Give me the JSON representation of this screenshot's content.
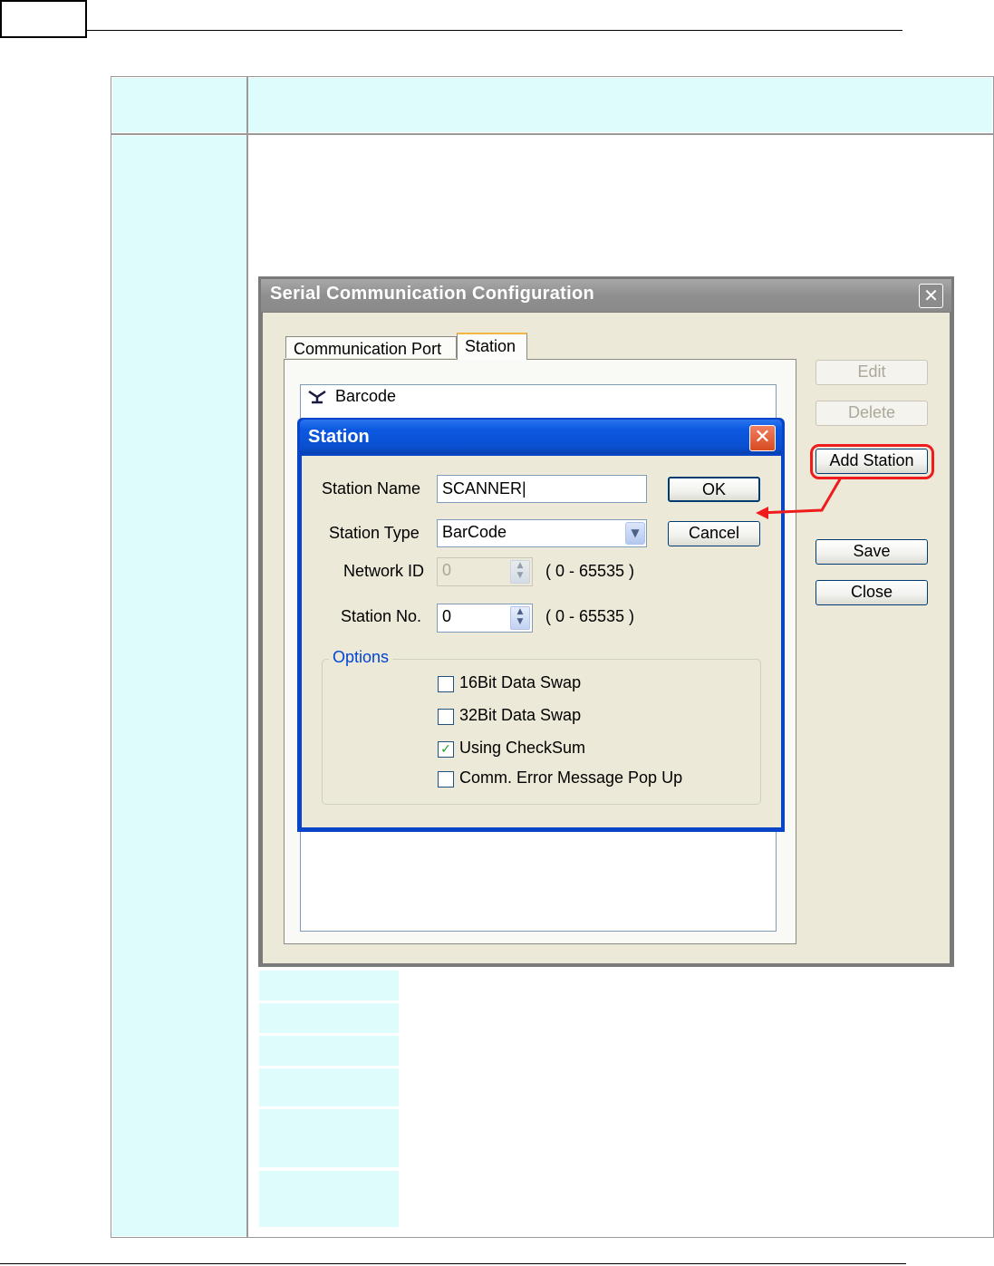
{
  "main_window": {
    "title": "Serial Communication Configuration",
    "close_glyph": "✕",
    "tabs": [
      {
        "label": "Communication Port",
        "active": false
      },
      {
        "label": "Station",
        "active": true
      }
    ],
    "station_list": [
      {
        "label": "Barcode",
        "icon": "antenna-icon"
      }
    ],
    "buttons": {
      "edit": "Edit",
      "delete": "Delete",
      "add_station": "Add Station",
      "save": "Save",
      "close": "Close"
    },
    "disabled_buttons": [
      "Edit",
      "Delete"
    ]
  },
  "station_dialog": {
    "title": "Station",
    "close_glyph": "✕",
    "fields": {
      "station_name_label": "Station Name",
      "station_name_value": "SCANNER|",
      "station_type_label": "Station Type",
      "station_type_value": "BarCode",
      "network_id_label": "Network ID",
      "network_id_value": "0",
      "network_id_range": "( 0 - 65535 )",
      "station_no_label": "Station No.",
      "station_no_value": "0",
      "station_no_range": "( 0 - 65535 )"
    },
    "buttons": {
      "ok": "OK",
      "cancel": "Cancel"
    },
    "options": {
      "legend": "Options",
      "items": [
        {
          "label": "16Bit Data Swap",
          "checked": false
        },
        {
          "label": "32Bit Data Swap",
          "checked": false
        },
        {
          "label": "Using CheckSum",
          "checked": true
        },
        {
          "label": "Comm. Error Message Pop Up",
          "checked": false
        }
      ]
    },
    "check_glyph": "✓",
    "dropdown_glyph": "▼",
    "spin_glyph_up": "▲",
    "spin_glyph_down": "▼"
  },
  "colors": {
    "table_cell_background": "#dffcfd",
    "highlight": "#ee1c1c",
    "dialog_title_blue": "#0a4fd0",
    "inactive_title_gray": "#8f8f8f",
    "options_legend": "#0046d5"
  }
}
